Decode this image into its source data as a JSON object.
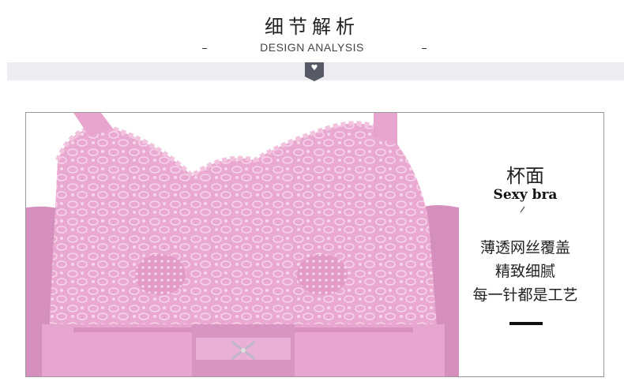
{
  "header": {
    "title_cn": "细节解析",
    "title_en": "DESIGN ANALYSIS"
  },
  "detail": {
    "heading_cn": "杯面",
    "heading_en": "Sexy bra",
    "desc_lines": [
      "薄透网丝覆盖",
      "精致细腻",
      "每一针都是工艺"
    ]
  },
  "colors": {
    "band": "#ececf1",
    "tab": "#555a66",
    "fabric": "#e9a9d0",
    "fabric_dark": "#d98cbd"
  },
  "icons": {
    "divider": "heart-icon"
  }
}
